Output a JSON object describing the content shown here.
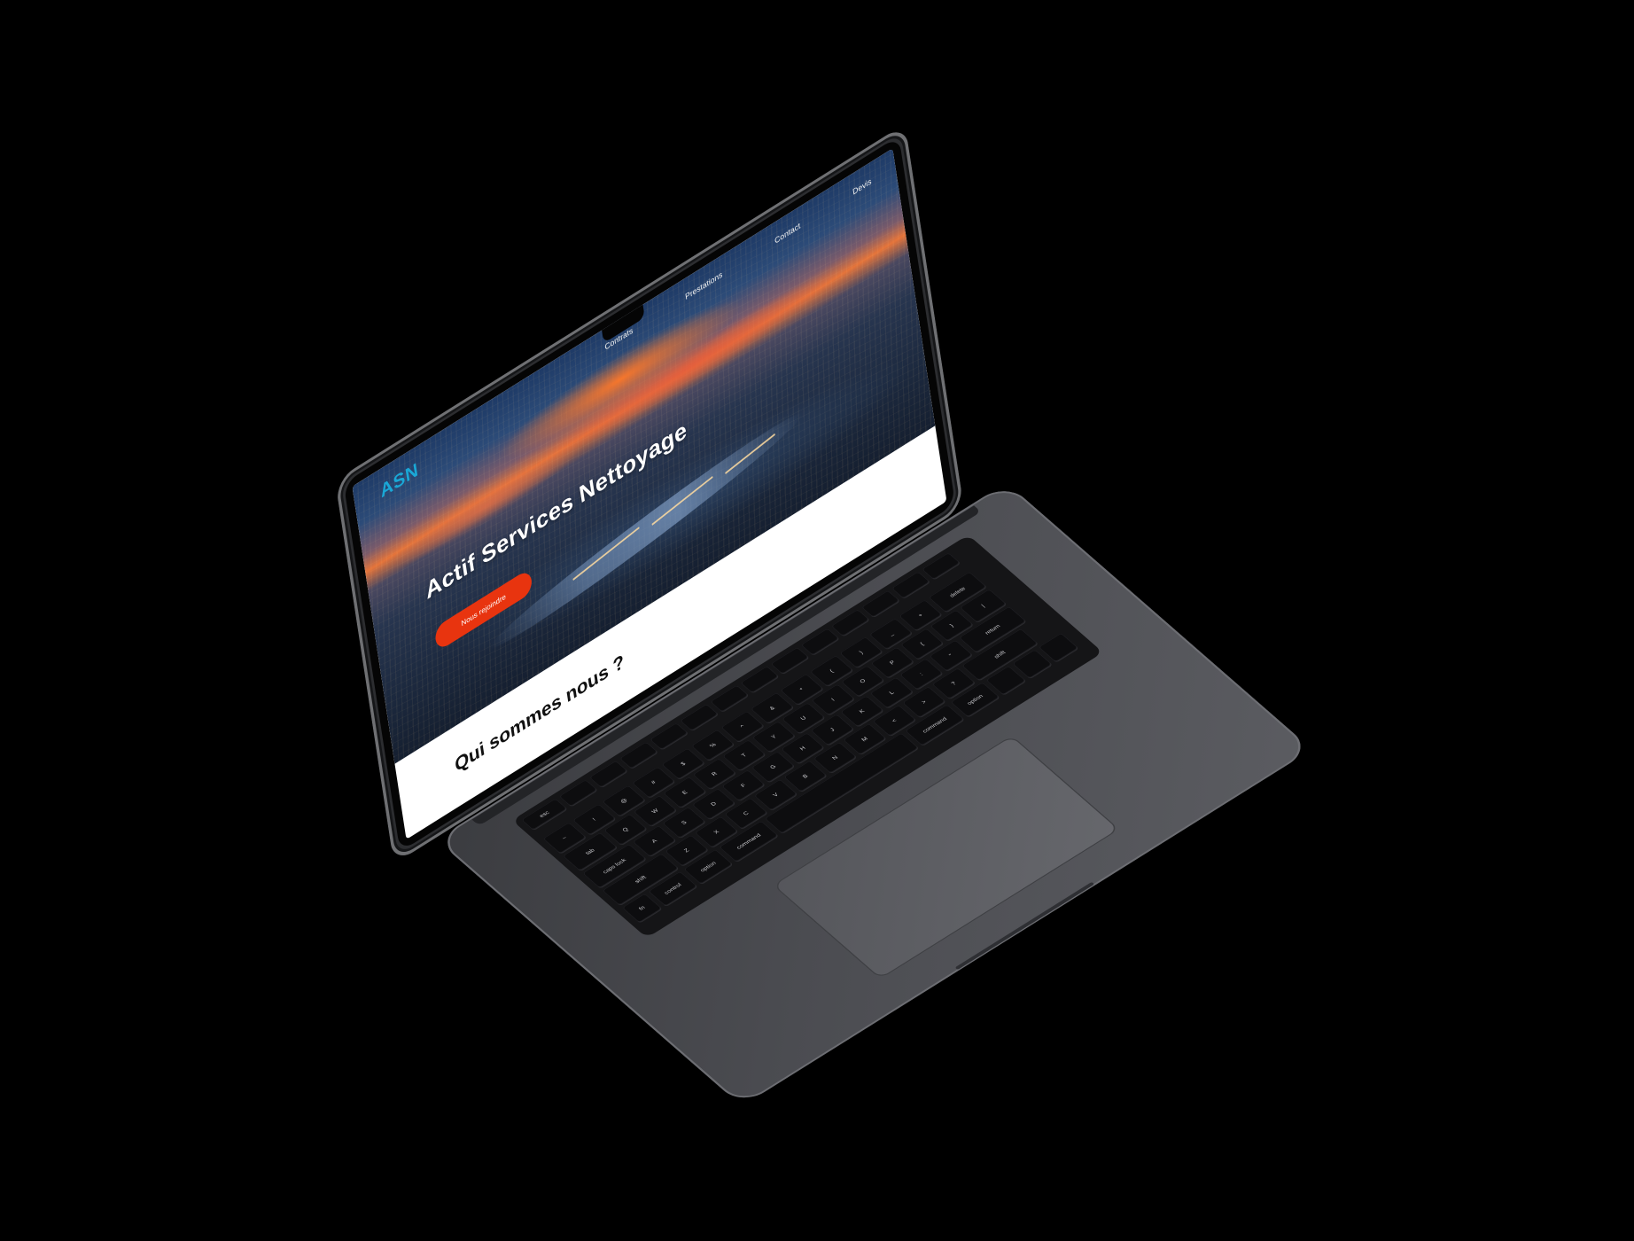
{
  "website": {
    "logo": "ASN",
    "nav": [
      "Contrats",
      "Prestations",
      "Contact",
      "Devis"
    ],
    "hero_title": "Actif Services Nettoyage",
    "cta_label": "Nous rejoindre",
    "section_title": "Qui sommes nous ?"
  },
  "keyboard": {
    "row1": [
      "esc",
      "",
      "",
      "",
      "",
      "",
      "",
      "",
      "",
      "",
      "",
      "",
      "",
      ""
    ],
    "row2": [
      "~",
      "!",
      "@",
      "#",
      "$",
      "%",
      "^",
      "&",
      "*",
      "(",
      ")",
      "_",
      "+",
      "delete"
    ],
    "row3": [
      "tab",
      "Q",
      "W",
      "E",
      "R",
      "T",
      "Y",
      "U",
      "I",
      "O",
      "P",
      "{",
      "}",
      "|"
    ],
    "row4": [
      "caps lock",
      "A",
      "S",
      "D",
      "F",
      "G",
      "H",
      "J",
      "K",
      "L",
      ":",
      "\"",
      "return"
    ],
    "row5": [
      "shift",
      "Z",
      "X",
      "C",
      "V",
      "B",
      "N",
      "M",
      "<",
      ">",
      "?",
      "shift"
    ],
    "row6": [
      "fn",
      "control",
      "option",
      "command",
      "",
      "command",
      "option",
      "",
      "",
      ""
    ]
  },
  "colors": {
    "logo": "#1aa7d6",
    "cta": "#e8340f",
    "laptop_body": "#4b4c51"
  }
}
